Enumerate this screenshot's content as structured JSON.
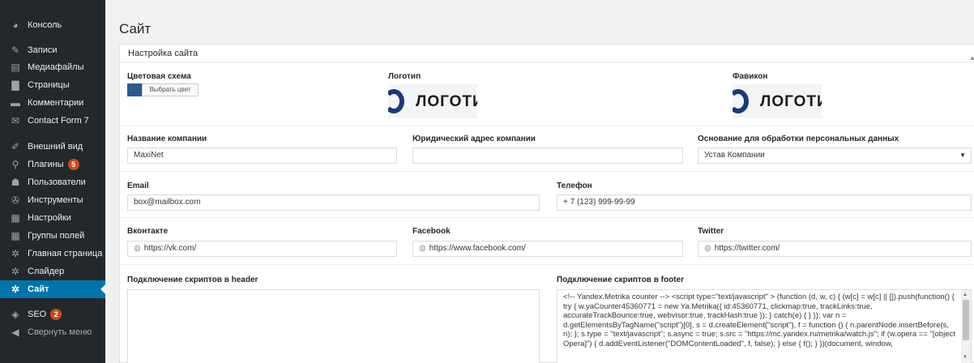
{
  "sidebar": {
    "items": [
      {
        "label": "Консоль",
        "icon": "dashboard-icon",
        "glyph": "◕"
      },
      {
        "label": "Записи",
        "icon": "pin-icon",
        "glyph": "✎"
      },
      {
        "label": "Медиафайлы",
        "icon": "media-icon",
        "glyph": "▤"
      },
      {
        "label": "Страницы",
        "icon": "pages-icon",
        "glyph": "▇"
      },
      {
        "label": "Комментарии",
        "icon": "comments-icon",
        "glyph": "▬"
      },
      {
        "label": "Contact Form 7",
        "icon": "mail-icon",
        "glyph": "✉"
      },
      {
        "label": "Внешний вид",
        "icon": "appearance-icon",
        "glyph": "✐"
      },
      {
        "label": "Плагины",
        "icon": "plugins-icon",
        "glyph": "⚲",
        "badge": "5"
      },
      {
        "label": "Пользователи",
        "icon": "users-icon",
        "glyph": "☗"
      },
      {
        "label": "Инструменты",
        "icon": "tools-icon",
        "glyph": "✇"
      },
      {
        "label": "Настройки",
        "icon": "settings-icon",
        "glyph": "▦"
      },
      {
        "label": "Группы полей",
        "icon": "fields-icon",
        "glyph": "▦"
      },
      {
        "label": "Главная страница",
        "icon": "gear-icon",
        "glyph": "✲"
      },
      {
        "label": "Слайдер",
        "icon": "gear-icon",
        "glyph": "✲"
      },
      {
        "label": "Сайт",
        "icon": "gear-icon",
        "glyph": "✲",
        "active": true
      },
      {
        "label": "SEO",
        "icon": "seo-icon",
        "glyph": "◈",
        "badge": "2"
      },
      {
        "label": "Свернуть меню",
        "icon": "collapse-icon",
        "glyph": "◀"
      }
    ]
  },
  "page": {
    "title": "Сайт"
  },
  "panel": {
    "title": "Настройка сайта"
  },
  "fields": {
    "color_scheme": {
      "label": "Цветовая схема",
      "button": "Выбрать цвет",
      "color": "#2a5a8e"
    },
    "logo": {
      "label": "Логотип",
      "text": "ЛОГОТИ"
    },
    "favicon": {
      "label": "Фавикон",
      "text": "ЛОГОТИ"
    },
    "company": {
      "label": "Название компании",
      "value": "MaxiNet"
    },
    "legal_address": {
      "label": "Юридический адрес компании",
      "value": ""
    },
    "data_basis": {
      "label": "Основание для обработки персональных данных",
      "value": "Устав Компании"
    },
    "email": {
      "label": "Email",
      "value": "box@mailbox.com"
    },
    "phone": {
      "label": "Телефон",
      "value": "+ 7 (123) 999-99-99"
    },
    "vk": {
      "label": "Вконтакте",
      "value": "https://vk.com/"
    },
    "facebook": {
      "label": "Facebook",
      "value": "https://www.facebook.com/"
    },
    "twitter": {
      "label": "Twitter",
      "value": "https://twitter.com/"
    },
    "header_scripts": {
      "label": "Подключение скриптов в header",
      "value": ""
    },
    "footer_scripts": {
      "label": "Подключение скриптов в footer",
      "value": "<!-- Yandex.Metrika counter --> <script type=\"text/javascript\" > (function (d, w, c) { (w[c] = w[c] || []).push(function() { try { w.yaCounter45360771 = new Ya.Metrika({ id:45360771, clickmap:true, trackLinks:true, accurateTrackBounce:true, webvisor:true, trackHash:true }); } catch(e) { } }); var n = d.getElementsByTagName(\"script\")[0], s = d.createElement(\"script\"), f = function () { n.parentNode.insertBefore(s, n); }; s.type = \"text/javascript\"; s.async = true; s.src = \"https://mc.yandex.ru/metrika/watch.js\"; if (w.opera == \"[object Opera]\") { d.addEventListener(\"DOMContentLoaded\", f, false); } else { f(); } })(document, window,"
    }
  },
  "colors": {
    "sidebar_bg": "#23282d",
    "active": "#0073aa",
    "badge": "#ca4a1f",
    "logo_blue": "#1a3a78"
  }
}
